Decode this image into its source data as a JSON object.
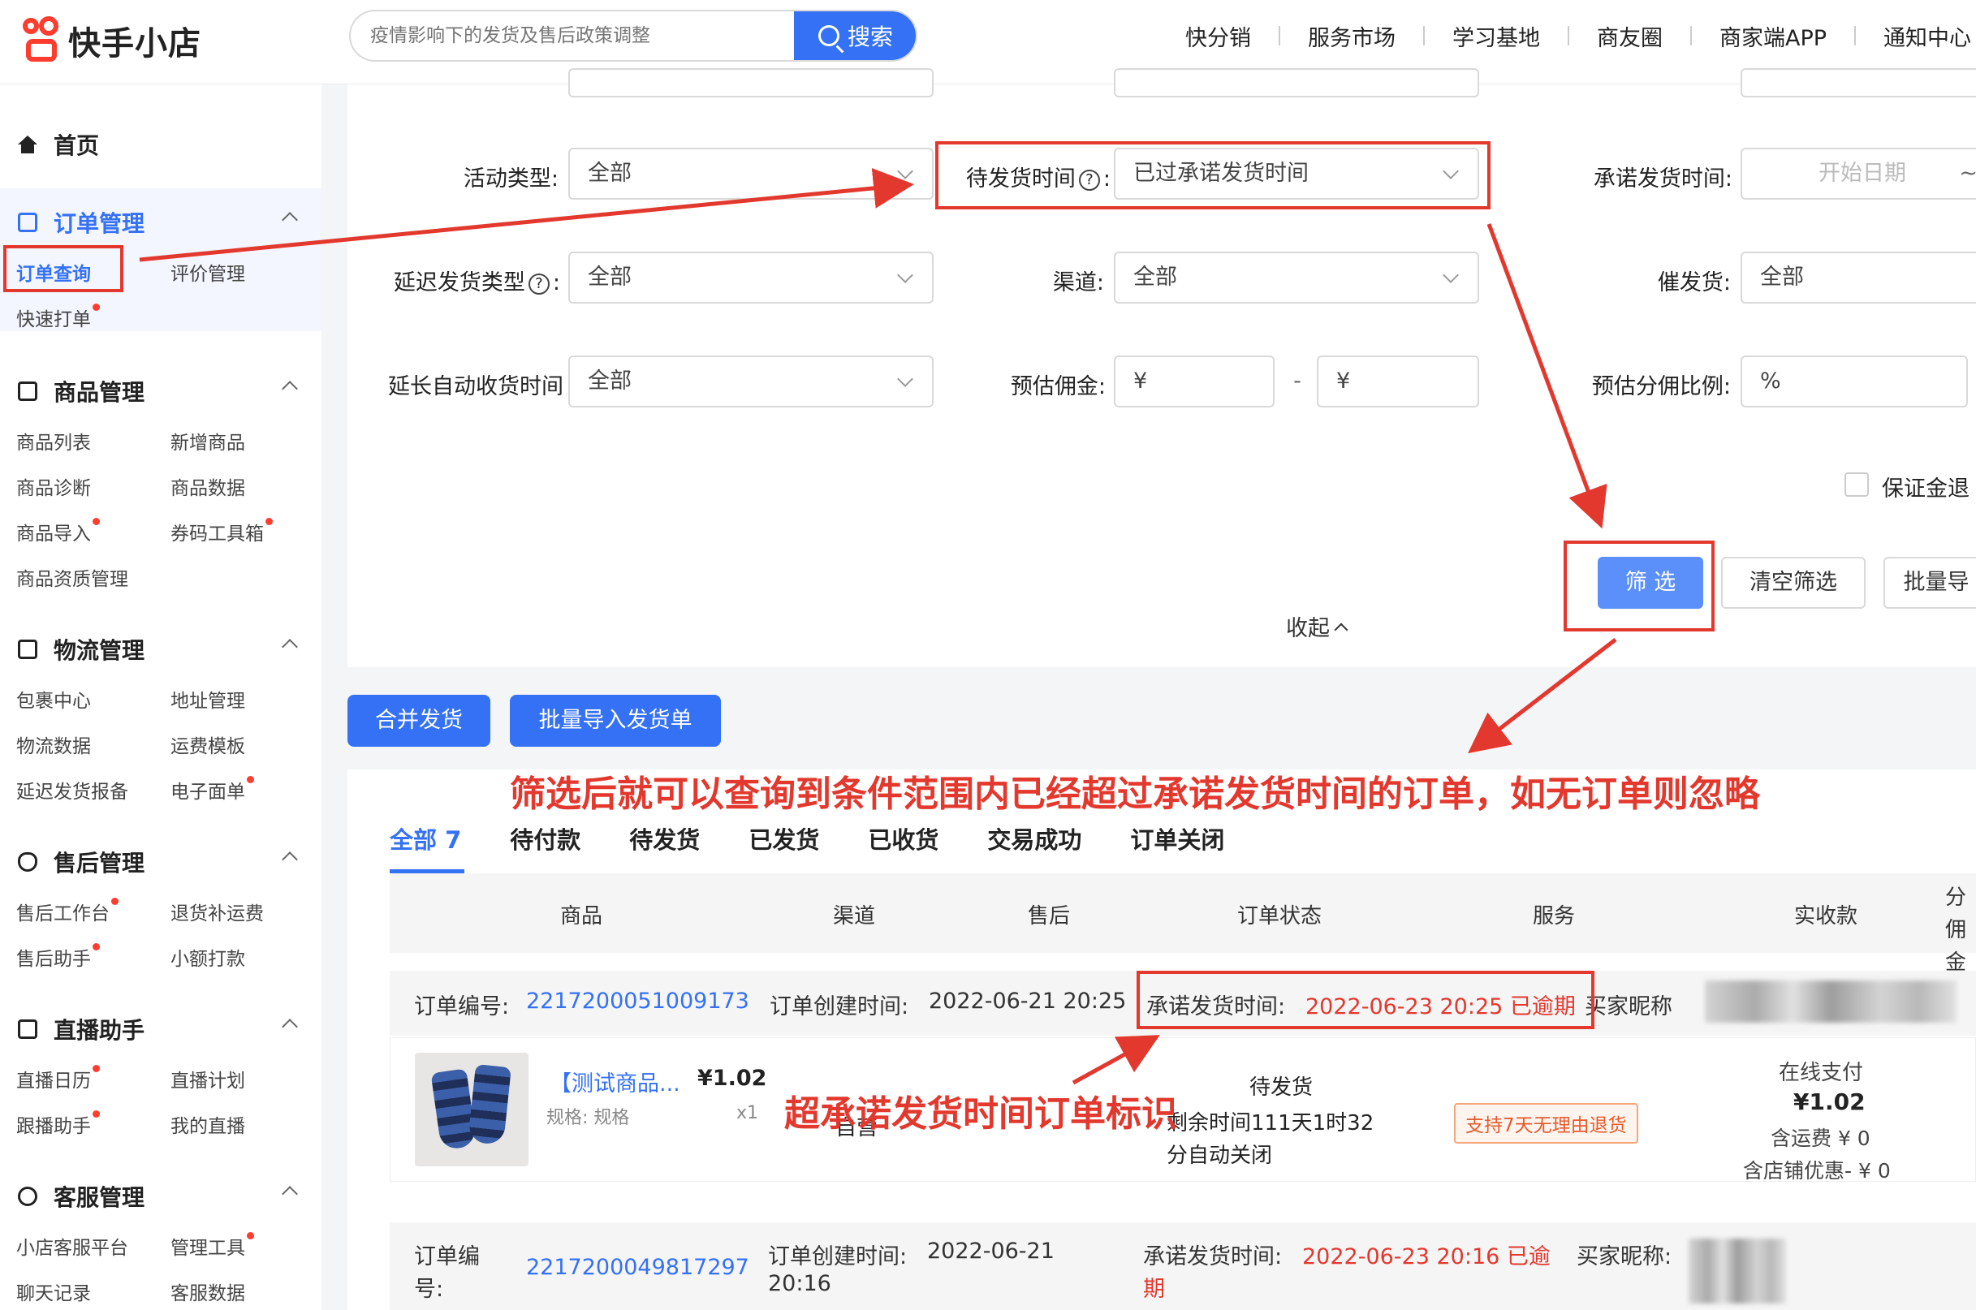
{
  "header": {
    "logo_text": "快手小店",
    "search_placeholder": "疫情影响下的发货及售后政策调整",
    "search_button": "搜索",
    "nav": [
      "快分销",
      "服务市场",
      "学习基地",
      "商友圈",
      "商家端APP",
      "通知中心"
    ]
  },
  "sidebar": {
    "home": "首页",
    "sections": [
      {
        "title": "订单管理",
        "items": [
          "订单查询",
          "评价管理",
          "快速打单"
        ]
      },
      {
        "title": "商品管理",
        "items": [
          "商品列表",
          "新增商品",
          "商品诊断",
          "商品数据",
          "商品导入",
          "券码工具箱",
          "商品资质管理"
        ]
      },
      {
        "title": "物流管理",
        "items": [
          "包裹中心",
          "地址管理",
          "物流数据",
          "运费模板",
          "延迟发货报备",
          "电子面单"
        ]
      },
      {
        "title": "售后管理",
        "items": [
          "售后工作台",
          "退货补运费",
          "售后助手",
          "小额打款"
        ]
      },
      {
        "title": "直播助手",
        "items": [
          "直播日历",
          "直播计划",
          "跟播助手",
          "我的直播"
        ]
      },
      {
        "title": "客服管理",
        "items": [
          "小店客服平台",
          "管理工具",
          "聊天记录",
          "客服数据"
        ]
      }
    ]
  },
  "filters": {
    "activity_type_label": "活动类型:",
    "activity_type_value": "全部",
    "pending_time_label": "待发货时间",
    "pending_time_value": "已过承诺发货时间",
    "promise_time_label": "承诺发货时间:",
    "start_date_placeholder": "开始日期",
    "range_tilde": "~",
    "delay_type_label": "延迟发货类型",
    "delay_type_value": "全部",
    "channel_label": "渠道:",
    "channel_value": "全部",
    "urge_label": "催发货:",
    "urge_value": "全部",
    "extend_label": "延长自动收货时间",
    "extend_value": "全部",
    "commission_label": "预估佣金:",
    "yuan": "¥",
    "dash": "-",
    "ratio_label": "预估分佣比例:",
    "percent": "%",
    "deposit_label": "保证金退",
    "filter_btn": "筛 选",
    "clear_btn": "清空筛选",
    "batch_btn": "批量导",
    "collapse": "收起"
  },
  "actions": {
    "merge": "合并发货",
    "import": "批量导入发货单"
  },
  "tabs": [
    "全部 7",
    "待付款",
    "待发货",
    "已发货",
    "已收货",
    "交易成功",
    "订单关闭"
  ],
  "table_headers": [
    "商品",
    "渠道",
    "售后",
    "订单状态",
    "服务",
    "实收款",
    "分佣金"
  ],
  "order1": {
    "no_label": "订单编号:",
    "no": "2217200051009173",
    "created_label": "订单创建时间:",
    "created": "2022-06-21 20:25",
    "promise_label": "承诺发货时间:",
    "promise": "2022-06-23 20:25 已逾期",
    "buyer_label": "买家昵称",
    "product_name": "【测试商品...",
    "price": "¥1.02",
    "spec": "规格: 规格",
    "qty": "x1",
    "channel": "自营",
    "status": "待发货",
    "remain": "剩余时间111天1时32",
    "remain2": "分自动关闭",
    "service": "支持7天无理由退货",
    "pay_method": "在线支付",
    "paid": "¥1.02",
    "shipping": "含运费 ¥ 0",
    "discount": "含店铺优惠- ¥ 0"
  },
  "order2": {
    "no_label": "订单编",
    "no_label2": "号:",
    "no": "2217200049817297",
    "created_label": "订单创建时间:",
    "created": "2022-06-21",
    "created2": "20:16",
    "promise_label": "承诺发货时间:",
    "promise": "2022-06-23 20:16 已逾",
    "promise2": "期",
    "buyer_label": "买家昵称:"
  },
  "annotations": {
    "main": "筛选后就可以查询到条件范围内已经超过承诺发货时间的订单，如无订单则忽略",
    "mark": "超承诺发货时间订单标识"
  },
  "colors": {
    "accent": "#3471f5",
    "annotation": "#e3382d",
    "brand": "#fe3d2f"
  }
}
